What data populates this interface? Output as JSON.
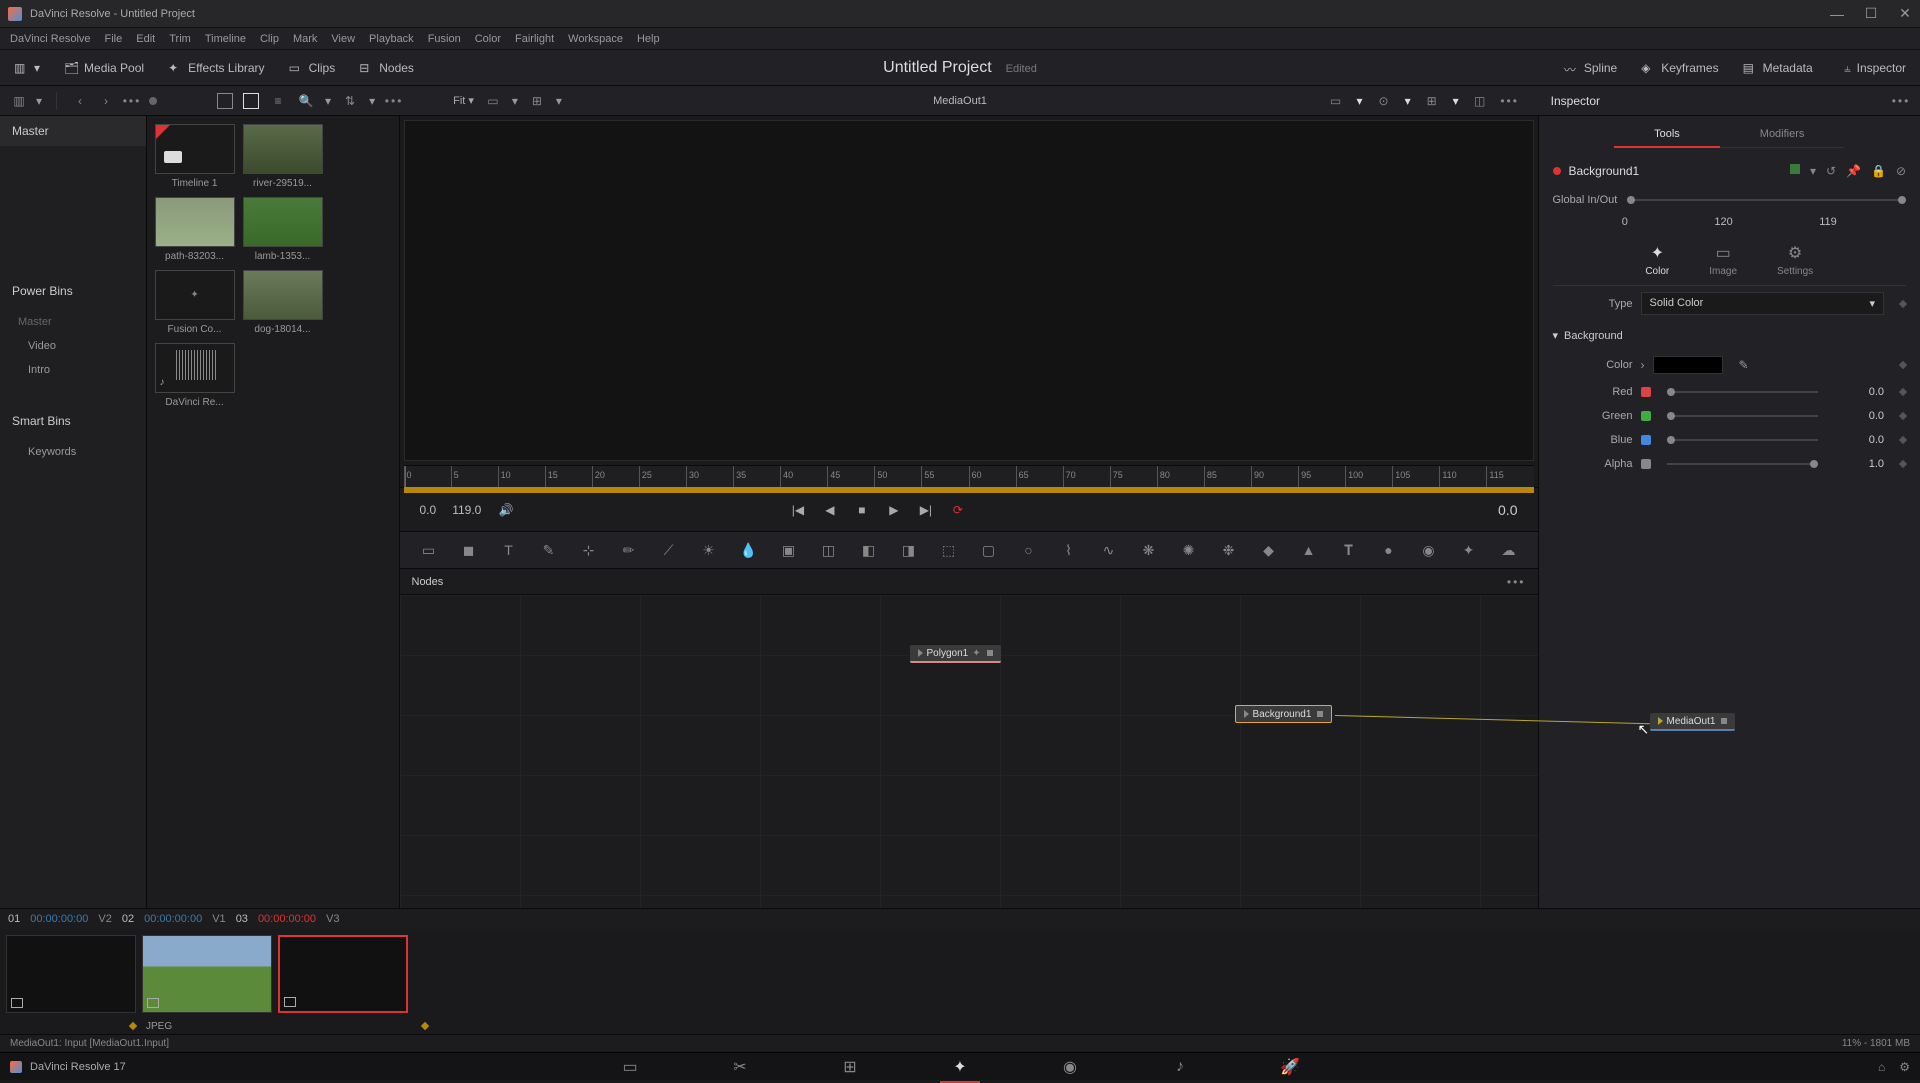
{
  "titlebar": {
    "app": "DaVinci Resolve",
    "project": "Untitled Project"
  },
  "menubar": [
    "DaVinci Resolve",
    "File",
    "Edit",
    "Trim",
    "Timeline",
    "Clip",
    "Mark",
    "View",
    "Playback",
    "Fusion",
    "Color",
    "Fairlight",
    "Workspace",
    "Help"
  ],
  "toolbar": {
    "media_pool": "Media Pool",
    "effects": "Effects Library",
    "clips": "Clips",
    "nodes": "Nodes",
    "project": "Untitled Project",
    "edited": "Edited",
    "spline": "Spline",
    "keyframes": "Keyframes",
    "metadata": "Metadata",
    "inspector": "Inspector"
  },
  "subbar": {
    "fit": "Fit ▾",
    "viewer_title": "MediaOut1",
    "inspector": "Inspector"
  },
  "sidebar": {
    "master": "Master",
    "power_bins": "Power Bins",
    "bins": [
      "Master",
      "Video",
      "Intro"
    ],
    "smart_bins": "Smart Bins",
    "smart_items": [
      "Keywords"
    ]
  },
  "thumbs": [
    {
      "label": "Timeline 1",
      "kind": "timeline"
    },
    {
      "label": "river-29519...",
      "kind": "river"
    },
    {
      "label": "path-83203...",
      "kind": "path"
    },
    {
      "label": "lamb-1353...",
      "kind": "lamb"
    },
    {
      "label": "Fusion Co...",
      "kind": "fusion"
    },
    {
      "label": "dog-18014...",
      "kind": "dog"
    },
    {
      "label": "DaVinci Re...",
      "kind": "audio"
    }
  ],
  "ruler": {
    "ticks": [
      "0",
      "5",
      "10",
      "15",
      "20",
      "25",
      "30",
      "35",
      "40",
      "45",
      "50",
      "55",
      "60",
      "65",
      "70",
      "75",
      "80",
      "85",
      "90",
      "95",
      "100",
      "105",
      "110",
      "115"
    ]
  },
  "transport": {
    "start": "0.0",
    "end": "119.0",
    "right": "0.0"
  },
  "nodes_panel": {
    "title": "Nodes",
    "poly": "Polygon1",
    "bg": "Background1",
    "out": "MediaOut1"
  },
  "clipstrip": {
    "items": [
      {
        "idx": "01",
        "tc": "00:00:00:00",
        "red": false,
        "trk": "V2"
      },
      {
        "idx": "02",
        "tc": "00:00:00:00",
        "red": false,
        "trk": "V1"
      },
      {
        "idx": "03",
        "tc": "00:00:00:00",
        "red": true,
        "trk": "V3"
      }
    ],
    "format": "JPEG"
  },
  "statusbar": {
    "left": "MediaOut1: Input   [MediaOut1.Input]",
    "right": "11% - 1801 MB"
  },
  "bottombar": {
    "app": "DaVinci Resolve 17"
  },
  "inspector": {
    "title": "Inspector",
    "tabs": [
      "Tools",
      "Modifiers"
    ],
    "node": "Background1",
    "global": "Global In/Out",
    "vals": [
      "0",
      "120",
      "119"
    ],
    "modes": [
      "Color",
      "Image",
      "Settings"
    ],
    "type_label": "Type",
    "type_val": "Solid Color",
    "section": "Background",
    "color_label": "Color",
    "channels": [
      {
        "name": "Red",
        "val": "0.0",
        "col": "#d44"
      },
      {
        "name": "Green",
        "val": "0.0",
        "col": "#4a4"
      },
      {
        "name": "Blue",
        "val": "0.0",
        "col": "#48d"
      },
      {
        "name": "Alpha",
        "val": "1.0",
        "col": "#888"
      }
    ]
  }
}
